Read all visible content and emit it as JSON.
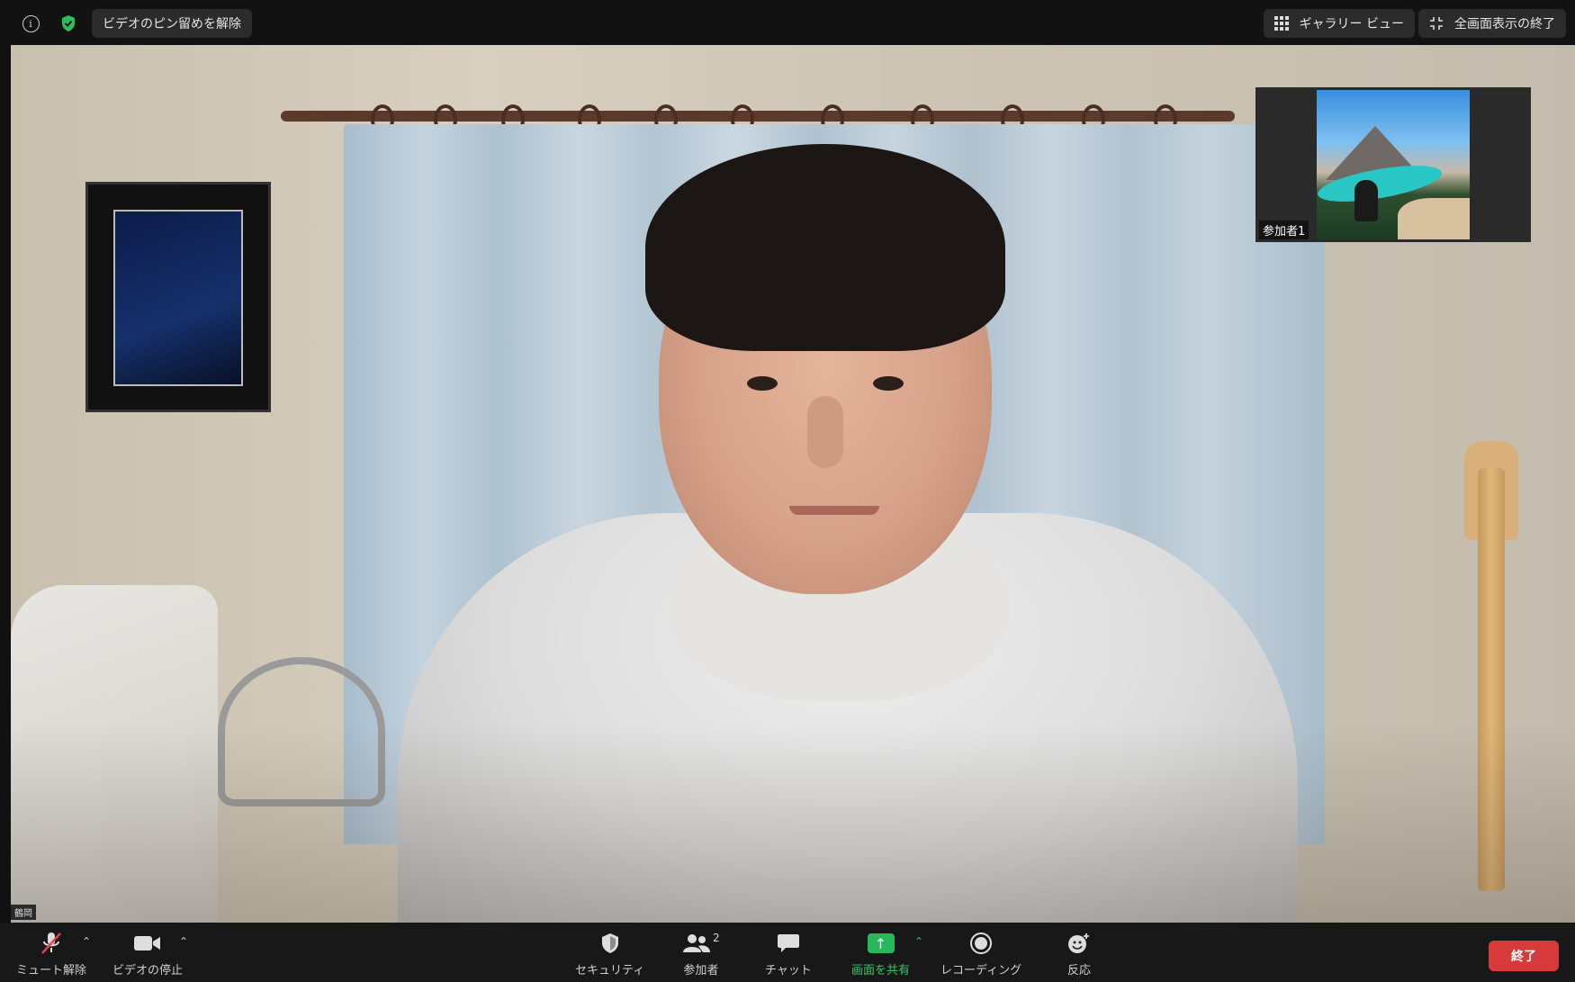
{
  "topbar": {
    "unpin_label": "ビデオのピン留めを解除",
    "gallery_label": "ギャラリー ビュー",
    "exit_fullscreen_label": "全画面表示の終了",
    "info_icon": "i"
  },
  "thumbnail": {
    "participant_label": "参加者1"
  },
  "self_view": {
    "name_label": "鶴岡"
  },
  "toolbar": {
    "unmute_label": "ミュート解除",
    "stop_video_label": "ビデオの停止",
    "security_label": "セキュリティ",
    "participants_label": "参加者",
    "participants_count": "2",
    "chat_label": "チャット",
    "share_label": "画面を共有",
    "record_label": "レコーディング",
    "reactions_label": "反応",
    "end_label": "終了"
  },
  "colors": {
    "share_green": "#26b85a",
    "end_red": "#d63a3a",
    "shield_green": "#2bc05c"
  },
  "icons": {
    "info": "info-icon",
    "shield": "shield-check-icon",
    "grid": "grid-icon",
    "exit_fullscreen": "exit-fullscreen-icon",
    "mic_muted": "mic-muted-icon",
    "camera": "camera-icon",
    "security": "security-shield-icon",
    "participants": "participants-icon",
    "chat": "chat-bubble-icon",
    "share": "share-screen-icon",
    "record": "record-icon",
    "reactions": "reaction-emoji-icon"
  }
}
